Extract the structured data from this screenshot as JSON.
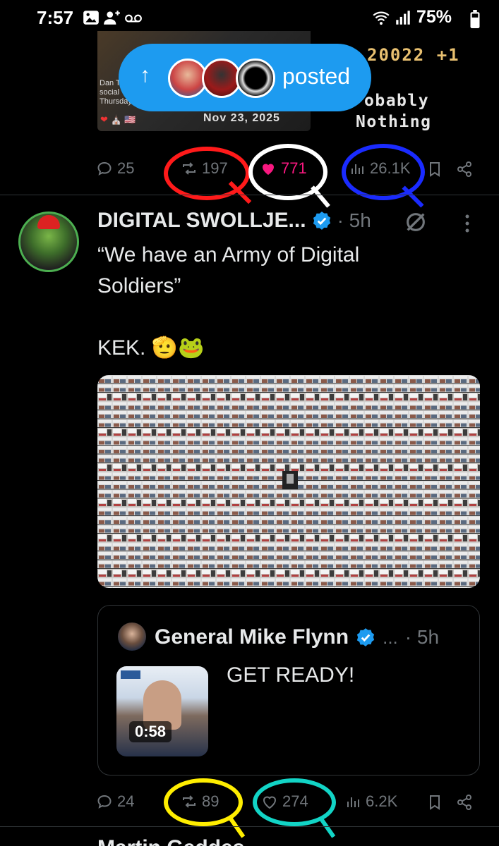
{
  "status_bar": {
    "time": "7:57",
    "battery": "75%"
  },
  "top_post": {
    "media": {
      "caption": "Dan T social Thursday",
      "date": "Nov 23, 2025"
    },
    "side_text": {
      "ticker": "20022 +1",
      "line1": "obably",
      "line2": "Nothing"
    },
    "actions": {
      "replies": "25",
      "reposts": "197",
      "likes": "771",
      "views": "26.1K"
    }
  },
  "posted_pill": {
    "label": "posted",
    "arrow": "↑"
  },
  "post": {
    "author": "DIGITAL SWOLLJE...",
    "time": "· 5h",
    "text_line1": "“We have an Army of Digital",
    "text_line2": "Soldiers”",
    "text_line3": "KEK. 🫡🐸",
    "quote": {
      "author": "General Mike Flynn",
      "ellipsis": "...",
      "time": "· 5h",
      "text": "GET READY!",
      "duration": "0:58"
    },
    "actions": {
      "replies": "24",
      "reposts": "89",
      "likes": "274",
      "views": "6.2K"
    }
  },
  "next_post": {
    "author": "Martin Geddes"
  },
  "colors": {
    "accent": "#1d9bf0",
    "like_active": "#f91880",
    "ring_red": "#ff1a1a",
    "ring_white": "#ffffff",
    "ring_blue": "#1a2bff",
    "ring_yellow": "#ffee00",
    "ring_cyan": "#12d4c6"
  }
}
